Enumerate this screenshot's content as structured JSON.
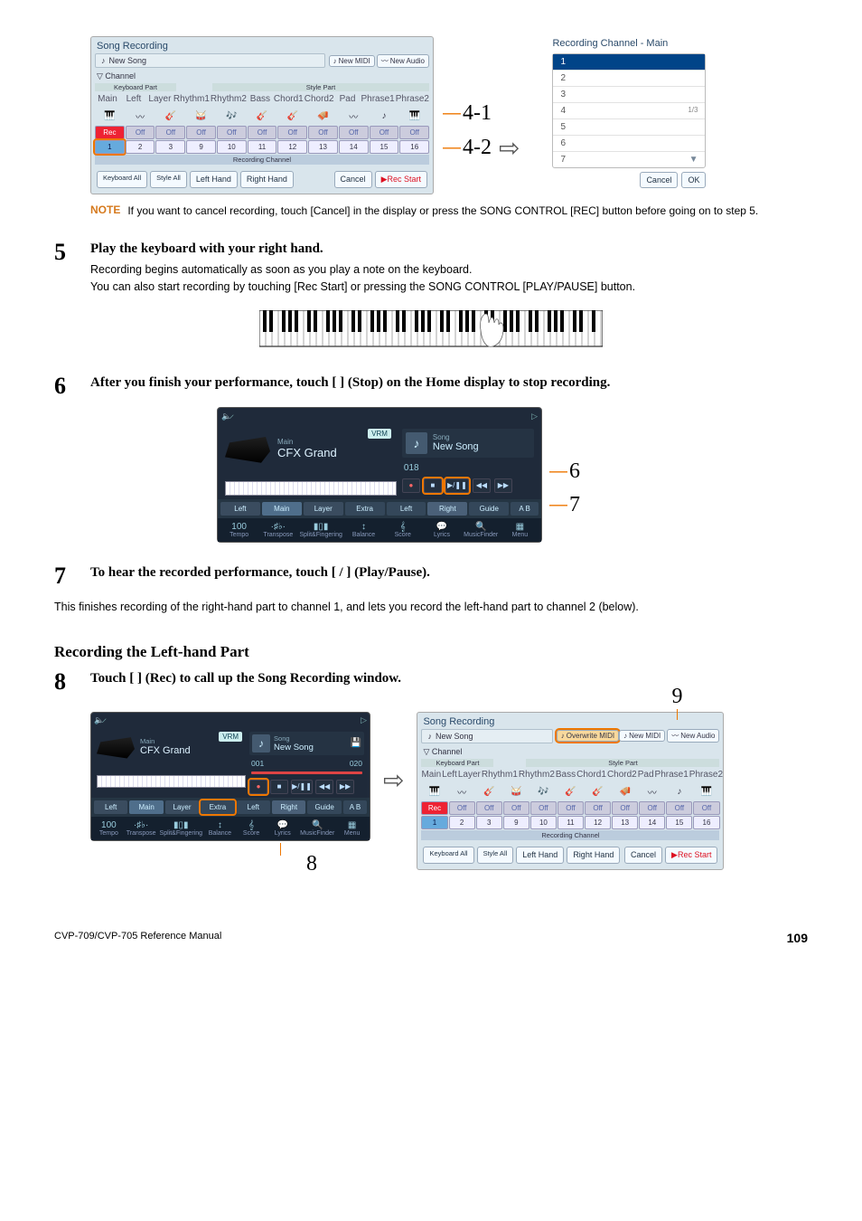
{
  "callouts": {
    "c41": "4-1",
    "c42": "4-2",
    "c6": "6",
    "c7": "7",
    "c8": "8",
    "c9": "9"
  },
  "fig1": {
    "title": "Song Recording",
    "songTitle": "New Song",
    "newMidi": "New MIDI",
    "newAudio": "New Audio",
    "channel": "Channel",
    "kbPart": "Keyboard Part",
    "stylePart": "Style Part",
    "parts": [
      "Main",
      "Left",
      "Layer",
      "Rhythm1",
      "Rhythm2",
      "Bass",
      "Chord1",
      "Chord2",
      "Pad",
      "Phrase1",
      "Phrase2"
    ],
    "rec": "Rec",
    "off": "Off",
    "channels": [
      "1",
      "2",
      "3",
      "9",
      "10",
      "11",
      "12",
      "13",
      "14",
      "15",
      "16"
    ],
    "recChanLabel": "Recording Channel",
    "kbAll": "Keyboard All",
    "styleAll": "Style All",
    "leftHand": "Left Hand",
    "rightHand": "Right Hand",
    "cancel": "Cancel",
    "recStart": "▶Rec Start"
  },
  "fig1b": {
    "title": "Recording Channel - Main",
    "rows": [
      "1",
      "2",
      "3",
      "4",
      "5",
      "6",
      "7"
    ],
    "page": "1/3",
    "cancel": "Cancel",
    "ok": "OK"
  },
  "note1": {
    "label": "NOTE",
    "text": "If you want to cancel recording, touch [Cancel] in the display or press the SONG CONTROL [REC] button before going on to step 5."
  },
  "step5": {
    "num": "5",
    "head": "Play the keyboard with your right hand.",
    "body": "Recording begins automatically as soon as you play a note on the keyboard.\nYou can also start recording by touching [Rec Start] or pressing the SONG CONTROL [PLAY/PAUSE] button."
  },
  "step6": {
    "num": "6",
    "head": "After you finish your performance, touch [     ] (Stop) on the Home display to stop recording."
  },
  "fig2": {
    "vrm": "VRM",
    "main": "Main",
    "voice": "CFX Grand",
    "songLabel": "Song",
    "songName": "New Song",
    "counter": "018",
    "tabs": [
      "Left",
      "Main",
      "Layer",
      "Extra",
      "Left",
      "Right",
      "Guide",
      "A B"
    ],
    "menu": [
      "Tempo",
      "Transpose",
      "Split&Fingering",
      "Balance",
      "Score",
      "Lyrics",
      "MusicFinder",
      "Menu"
    ],
    "menuVals": [
      "100",
      "",
      "",
      "",
      "",
      "",
      "",
      ""
    ]
  },
  "step7": {
    "num": "7",
    "head": "To hear the recorded performance, touch [     /     ] (Play/Pause)."
  },
  "body7": "This finishes recording of the right-hand part to channel 1, and lets you record the left-hand part to channel 2 (below).",
  "section": "Recording the Left-hand Part",
  "step8": {
    "num": "8",
    "head": "Touch [     ] (Rec) to call up the Song Recording window."
  },
  "fig3": {
    "vrm": "VRM",
    "main": "Main",
    "voice": "CFX Grand",
    "songLabel": "Song",
    "songName": "New Song",
    "bar1": "001",
    "bar2": "020",
    "tabs": [
      "Left",
      "Main",
      "Layer",
      "Extra",
      "Left",
      "Right",
      "Guide",
      "A B"
    ],
    "menu": [
      "Tempo",
      "Transpose",
      "Split&Fingering",
      "Balance",
      "Score",
      "Lyrics",
      "MusicFinder",
      "Menu"
    ]
  },
  "fig4": {
    "title": "Song Recording",
    "songTitle": "New Song",
    "overwrite": "Overwrite MIDI",
    "newMidi": "New MIDI",
    "newAudio": "New Audio",
    "channel": "Channel",
    "kbPart": "Keyboard Part",
    "stylePart": "Style Part",
    "parts": [
      "Main",
      "Left",
      "Layer",
      "Rhythm1",
      "Rhythm2",
      "Bass",
      "Chord1",
      "Chord2",
      "Pad",
      "Phrase1",
      "Phrase2"
    ],
    "rec": "Rec",
    "off": "Off",
    "channels": [
      "1",
      "2",
      "3",
      "9",
      "10",
      "11",
      "12",
      "13",
      "14",
      "15",
      "16"
    ],
    "recChanLabel": "Recording Channel",
    "kbAll": "Keyboard All",
    "styleAll": "Style All",
    "leftHand": "Left Hand",
    "rightHand": "Right Hand",
    "cancel": "Cancel",
    "recStart": "▶Rec Start"
  },
  "footer": {
    "ref": "CVP-709/CVP-705 Reference Manual",
    "page": "109"
  }
}
